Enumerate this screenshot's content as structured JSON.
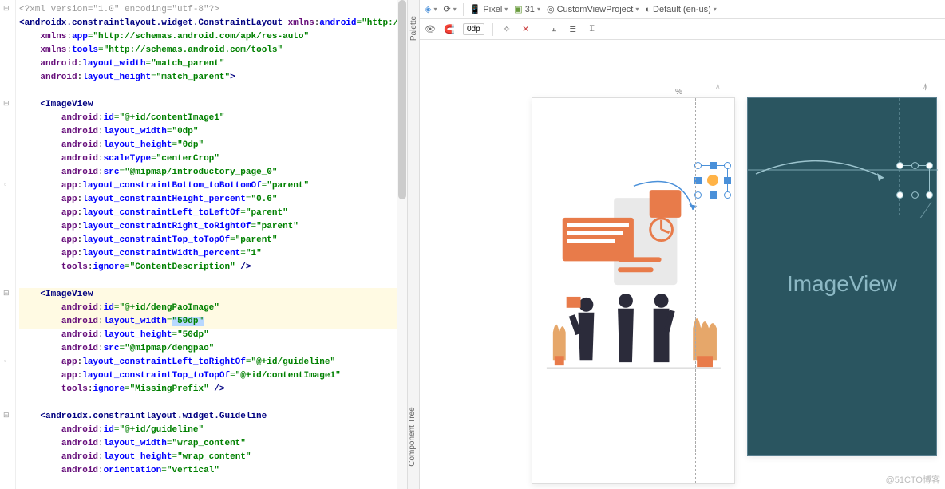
{
  "code": {
    "lines": [
      {
        "t": "<?xml version=\"1.0\" encoding=\"utf-8\"?>",
        "type": "decl",
        "hl": false
      },
      {
        "t": "<androidx.constraintlayout.widget.ConstraintLayout xmlns:android=\"http://schemas.android.com/",
        "type": "tag-open",
        "hl": false,
        "ns": "android",
        "attr": "xmlns:android",
        "val": "http://schemas.android.com/"
      },
      {
        "t": "    xmlns:app=\"http://schemas.android.com/apk/res-auto\"",
        "ns": "xmlns",
        "attr": "app",
        "val": "http://schemas.android.com/apk/res-auto"
      },
      {
        "t": "    xmlns:tools=\"http://schemas.android.com/tools\"",
        "ns": "xmlns",
        "attr": "tools",
        "val": "http://schemas.android.com/tools"
      },
      {
        "t": "    android:layout_width=\"match_parent\"",
        "ns": "android",
        "attr": "layout_width",
        "val": "match_parent"
      },
      {
        "t": "    android:layout_height=\"match_parent\">",
        "ns": "android",
        "attr": "layout_height",
        "val": "match_parent",
        "close": ">"
      },
      {
        "t": "",
        "blank": true
      },
      {
        "t": "    <ImageView",
        "type": "tag",
        "tag": "ImageView"
      },
      {
        "t": "        android:id=\"@+id/contentImage1\"",
        "ns": "android",
        "attr": "id",
        "val": "@+id/contentImage1"
      },
      {
        "t": "        android:layout_width=\"0dp\"",
        "ns": "android",
        "attr": "layout_width",
        "val": "0dp"
      },
      {
        "t": "        android:layout_height=\"0dp\"",
        "ns": "android",
        "attr": "layout_height",
        "val": "0dp"
      },
      {
        "t": "        android:scaleType=\"centerCrop\"",
        "ns": "android",
        "attr": "scaleType",
        "val": "centerCrop"
      },
      {
        "t": "        android:src=\"@mipmap/introductory_page_0\"",
        "ns": "android",
        "attr": "src",
        "val": "@mipmap/introductory_page_0"
      },
      {
        "t": "        app:layout_constraintBottom_toBottomOf=\"parent\"",
        "ns": "app",
        "attr": "layout_constraintBottom_toBottomOf",
        "val": "parent"
      },
      {
        "t": "        app:layout_constraintHeight_percent=\"0.6\"",
        "ns": "app",
        "attr": "layout_constraintHeight_percent",
        "val": "0.6"
      },
      {
        "t": "        app:layout_constraintLeft_toLeftOf=\"parent\"",
        "ns": "app",
        "attr": "layout_constraintLeft_toLeftOf",
        "val": "parent"
      },
      {
        "t": "        app:layout_constraintRight_toRightOf=\"parent\"",
        "ns": "app",
        "attr": "layout_constraintRight_toRightOf",
        "val": "parent"
      },
      {
        "t": "        app:layout_constraintTop_toTopOf=\"parent\"",
        "ns": "app",
        "attr": "layout_constraintTop_toTopOf",
        "val": "parent"
      },
      {
        "t": "        app:layout_constraintWidth_percent=\"1\"",
        "ns": "app",
        "attr": "layout_constraintWidth_percent",
        "val": "1"
      },
      {
        "t": "        tools:ignore=\"ContentDescription\" />",
        "ns": "tools",
        "attr": "ignore",
        "val": "ContentDescription",
        "close": " />"
      },
      {
        "t": "",
        "blank": true
      },
      {
        "t": "    <ImageView",
        "type": "tag",
        "tag": "ImageView",
        "hl": true
      },
      {
        "t": "        android:id=\"@+id/dengPaoImage\"",
        "ns": "android",
        "attr": "id",
        "val": "@+id/dengPaoImage",
        "hl": true
      },
      {
        "t": "        android:layout_width=\"50dp\"",
        "ns": "android",
        "attr": "layout_width",
        "val": "50dp",
        "hl": true,
        "selection": true
      },
      {
        "t": "        android:layout_height=\"50dp\"",
        "ns": "android",
        "attr": "layout_height",
        "val": "50dp"
      },
      {
        "t": "        android:src=\"@mipmap/dengpao\"",
        "ns": "android",
        "attr": "src",
        "val": "@mipmap/dengpao"
      },
      {
        "t": "        app:layout_constraintLeft_toRightOf=\"@+id/guideline\"",
        "ns": "app",
        "attr": "layout_constraintLeft_toRightOf",
        "val": "@+id/guideline"
      },
      {
        "t": "        app:layout_constraintTop_toTopOf=\"@+id/contentImage1\"",
        "ns": "app",
        "attr": "layout_constraintTop_toTopOf",
        "val": "@+id/contentImage1"
      },
      {
        "t": "        tools:ignore=\"MissingPrefix\" />",
        "ns": "tools",
        "attr": "ignore",
        "val": "MissingPrefix",
        "close": " />"
      },
      {
        "t": "",
        "blank": true
      },
      {
        "t": "    <androidx.constraintlayout.widget.Guideline",
        "type": "tag",
        "tag": "androidx.constraintlayout.widget.Guideline"
      },
      {
        "t": "        android:id=\"@+id/guideline\"",
        "ns": "android",
        "attr": "id",
        "val": "@+id/guideline"
      },
      {
        "t": "        android:layout_width=\"wrap_content\"",
        "ns": "android",
        "attr": "layout_width",
        "val": "wrap_content"
      },
      {
        "t": "        android:layout_height=\"wrap_content\"",
        "ns": "android",
        "attr": "layout_height",
        "val": "wrap_content"
      },
      {
        "t": "        android:orientation=\"vertical\"",
        "ns": "android",
        "attr": "orientation",
        "val": "vertical"
      }
    ]
  },
  "palette": {
    "label": "Palette",
    "tree_label": "Component Tree"
  },
  "toolbar": {
    "device_icon": "📱",
    "device": "Pixel",
    "api_icon": "▲",
    "api": "31",
    "theme_icon": "◎",
    "theme": "CustomViewProject",
    "locale_icon": "◐",
    "locale": "Default (en-us)",
    "eye": "👁",
    "magnet": "🧲",
    "margin": "0dp",
    "wand": "✨",
    "clear": "✕",
    "align_h": "≡",
    "align_v": "⫞",
    "guideline": "⌶"
  },
  "preview": {
    "ruler_pct": "%",
    "handle": "⌄",
    "imageview_label": "ImageView"
  },
  "watermark": "@51CTO博客"
}
